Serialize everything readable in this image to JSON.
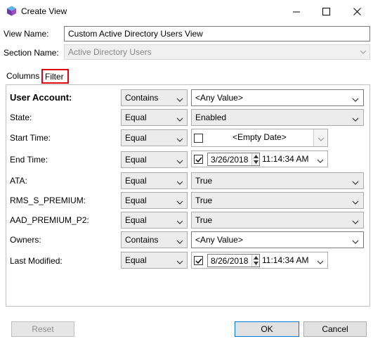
{
  "window": {
    "title": "Create View",
    "icon": "app-cube-icon"
  },
  "form": {
    "view_name_label": "View Name:",
    "view_name_value": "Custom Active Directory Users View",
    "section_name_label": "Section Name:",
    "section_name_value": "Active Directory Users"
  },
  "tabs": [
    {
      "label": "Columns",
      "selected": false
    },
    {
      "label": "Filter",
      "selected": true
    }
  ],
  "filters": [
    {
      "label": "User Account:",
      "operator": "Contains",
      "value": "<Any Value>",
      "kind": "text"
    },
    {
      "label": "State:",
      "operator": "Equal",
      "value": "Enabled",
      "kind": "select"
    },
    {
      "label": "Start Time:",
      "operator": "Equal",
      "value": "<Empty Date>",
      "kind": "emptydate",
      "checked": false
    },
    {
      "label": "End Time:",
      "operator": "Equal",
      "date": "3/26/2018",
      "time": "11:14:34 AM",
      "kind": "date",
      "checked": true
    },
    {
      "label": "ATA:",
      "operator": "Equal",
      "value": "True",
      "kind": "select"
    },
    {
      "label": "RMS_S_PREMIUM:",
      "operator": "Equal",
      "value": "True",
      "kind": "select"
    },
    {
      "label": "AAD_PREMIUM_P2:",
      "operator": "Equal",
      "value": "True",
      "kind": "select"
    },
    {
      "label": "Owners:",
      "operator": "Contains",
      "value": "<Any Value>",
      "kind": "text"
    },
    {
      "label": "Last Modified:",
      "operator": "Equal",
      "date": "8/26/2018",
      "time": "11:14:34 AM",
      "kind": "date",
      "checked": true
    }
  ],
  "buttons": {
    "reset": "Reset",
    "ok": "OK",
    "cancel": "Cancel"
  },
  "colors": {
    "highlight_border": "#e0000f",
    "default_button_border": "#0078d7"
  }
}
